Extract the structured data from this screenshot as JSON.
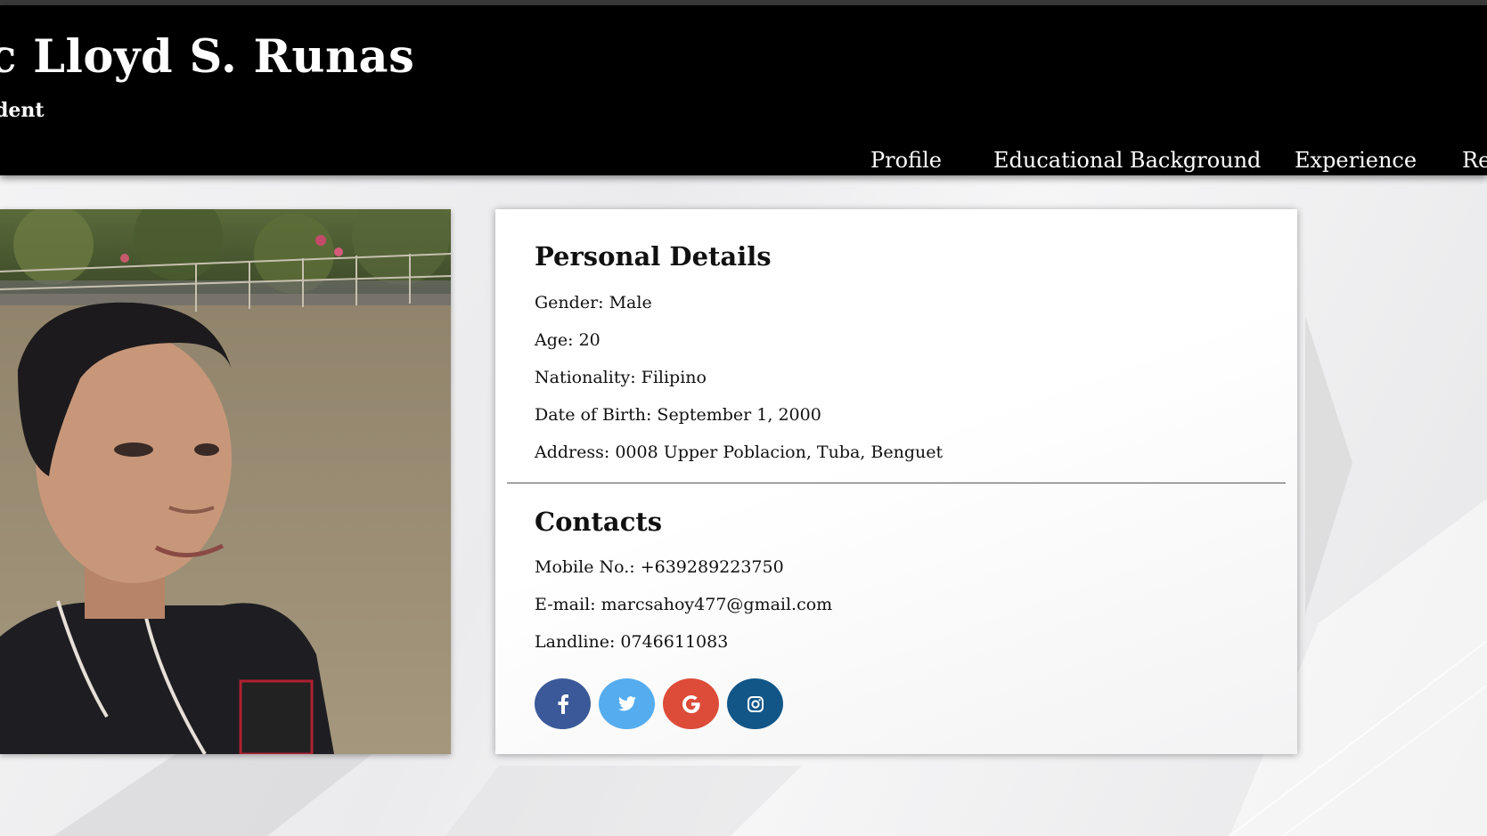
{
  "header": {
    "name": "rc Lloyd S. Runas",
    "role": "udent"
  },
  "nav": {
    "items": [
      {
        "label": "Profile"
      },
      {
        "label": "Educational Background"
      },
      {
        "label": "Experience"
      },
      {
        "label": "Re"
      }
    ]
  },
  "personal_details": {
    "title": "Personal Details",
    "gender": "Gender: Male",
    "age": "Age: 20",
    "nationality": "Nationality: Filipino",
    "date_of_birth": "Date of Birth: September 1, 2000",
    "address": "Address: 0008 Upper Poblacion, Tuba, Benguet"
  },
  "contacts": {
    "title": "Contacts",
    "mobile": "Mobile No.: +639289223750",
    "email": "E-mail: marcsahoy477@gmail.com",
    "landline": "Landline: 0746611083"
  },
  "social": {
    "facebook": {
      "icon": "facebook-icon",
      "color": "#3b5998"
    },
    "twitter": {
      "icon": "twitter-icon",
      "color": "#55acee"
    },
    "google": {
      "icon": "google-icon",
      "color": "#dd4b39"
    },
    "instagram": {
      "icon": "instagram-icon",
      "color": "#125688"
    }
  }
}
